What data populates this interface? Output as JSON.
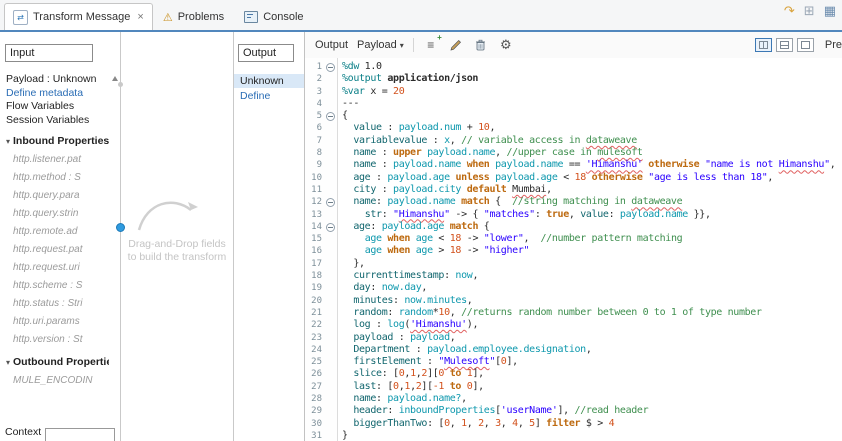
{
  "colors": {
    "accent_blue": "#5187bd",
    "link_blue": "#2a6db5",
    "selection_blue": "#d9e8f7",
    "anchor_blue": "#2f9be0"
  },
  "icons": {
    "transform": "⇄",
    "problems": "⚠",
    "chevron_down": "▾",
    "add_lines": "≡",
    "add_plus": "+",
    "gear": "⚙",
    "close": "×"
  },
  "window": {
    "toolbar_icons": [
      {
        "name": "annotation-icon",
        "glyph": "↷",
        "color": "#d9a33c"
      },
      {
        "name": "open-perspective-icon",
        "glyph": "⊞",
        "color": "#9aa7b5"
      },
      {
        "name": "mule-perspective-icon",
        "glyph": "▦",
        "color": "#6b8cae"
      }
    ]
  },
  "tabs": {
    "transform": {
      "label": "Transform Message",
      "close": "×"
    },
    "problems": {
      "label": "Problems"
    },
    "console": {
      "label": "Console"
    }
  },
  "input_panel": {
    "header": "Input",
    "context_label": "Context",
    "tree": [
      {
        "label": "Payload : Unknown",
        "style": "node"
      },
      {
        "label": "Define metadata",
        "style": "link"
      },
      {
        "label": "Flow Variables",
        "style": "node"
      },
      {
        "label": "Session Variables",
        "style": "node"
      },
      {
        "label": "Inbound Properties",
        "style": "group",
        "arrow": "▾"
      },
      {
        "label": "http.listener.pat",
        "style": "leaf"
      },
      {
        "label": "http.method : S",
        "style": "leaf"
      },
      {
        "label": "http.query.para",
        "style": "leaf"
      },
      {
        "label": "http.query.strin",
        "style": "leaf"
      },
      {
        "label": "http.remote.ad",
        "style": "leaf"
      },
      {
        "label": "http.request.pat",
        "style": "leaf"
      },
      {
        "label": "http.request.uri",
        "style": "leaf"
      },
      {
        "label": "http.scheme : S",
        "style": "leaf"
      },
      {
        "label": "http.status : Stri",
        "style": "leaf"
      },
      {
        "label": "http.uri.params",
        "style": "leaf"
      },
      {
        "label": "http.version : St",
        "style": "leaf"
      },
      {
        "label": "Outbound Propertie",
        "style": "group",
        "arrow": "▾"
      },
      {
        "label": "MULE_ENCODIN",
        "style": "leaf"
      }
    ]
  },
  "dropzone": {
    "hint1": "Drag-and-Drop fields",
    "hint2": "to build the transform"
  },
  "output_panel": {
    "header": "Output",
    "type": "Unknown",
    "define": "Define"
  },
  "editor": {
    "toolbar": {
      "output": "Output",
      "payload": "Payload",
      "preview": "Pre"
    },
    "lines": [
      {
        "n": 1,
        "f": 1,
        "t": [
          [
            "d",
            "%dw"
          ],
          [
            "p",
            " 1.0"
          ]
        ]
      },
      {
        "n": 2,
        "t": [
          [
            "d",
            "%output"
          ],
          [
            "p",
            " "
          ],
          [
            "b",
            "application/json"
          ]
        ]
      },
      {
        "n": 3,
        "t": [
          [
            "d",
            "%var"
          ],
          [
            "p",
            " x = "
          ],
          [
            "n",
            "20"
          ]
        ]
      },
      {
        "n": 4,
        "t": [
          [
            "p",
            "---"
          ]
        ]
      },
      {
        "n": 5,
        "f": 1,
        "t": [
          [
            "p",
            "{"
          ]
        ]
      },
      {
        "n": 6,
        "t": [
          [
            "p",
            "  "
          ],
          [
            "key",
            "value"
          ],
          [
            "p",
            " : "
          ],
          [
            "v",
            "payload.num"
          ],
          [
            "p",
            " + "
          ],
          [
            "n",
            "10"
          ],
          [
            "p",
            ","
          ]
        ]
      },
      {
        "n": 7,
        "t": [
          [
            "p",
            "  "
          ],
          [
            "key",
            "variablevalue"
          ],
          [
            "p",
            " : "
          ],
          [
            "v",
            "x"
          ],
          [
            "p",
            ", "
          ],
          [
            "c",
            "// variable access in "
          ],
          [
            "cu",
            "dataweave"
          ]
        ]
      },
      {
        "n": 8,
        "t": [
          [
            "p",
            "  "
          ],
          [
            "key",
            "name"
          ],
          [
            "p",
            " : "
          ],
          [
            "k",
            "upper"
          ],
          [
            "p",
            " "
          ],
          [
            "v",
            "payload.name"
          ],
          [
            "p",
            ", "
          ],
          [
            "c",
            "//upper case in "
          ],
          [
            "cu",
            "mulesoft"
          ]
        ]
      },
      {
        "n": 9,
        "t": [
          [
            "p",
            "  "
          ],
          [
            "key",
            "name"
          ],
          [
            "p",
            " : "
          ],
          [
            "v",
            "payload.name"
          ],
          [
            "p",
            " "
          ],
          [
            "k",
            "when"
          ],
          [
            "p",
            " "
          ],
          [
            "v",
            "payload.name"
          ],
          [
            "p",
            " == "
          ],
          [
            "su",
            "'Himanshu'"
          ],
          [
            "p",
            " "
          ],
          [
            "k",
            "otherwise"
          ],
          [
            "p",
            " "
          ],
          [
            "s",
            "\"name is not "
          ],
          [
            "su",
            "Himanshu"
          ],
          [
            "s",
            "\""
          ],
          [
            "p",
            ","
          ]
        ]
      },
      {
        "n": 10,
        "t": [
          [
            "p",
            "  "
          ],
          [
            "key",
            "age"
          ],
          [
            "p",
            " : "
          ],
          [
            "v",
            "payload.age"
          ],
          [
            "p",
            " "
          ],
          [
            "k",
            "unless"
          ],
          [
            "p",
            " "
          ],
          [
            "v",
            "payload.age"
          ],
          [
            "p",
            " < "
          ],
          [
            "n",
            "18"
          ],
          [
            "p",
            " "
          ],
          [
            "k",
            "otherwise"
          ],
          [
            "p",
            " "
          ],
          [
            "s",
            "\"age is less than 18\""
          ],
          [
            "p",
            ","
          ]
        ]
      },
      {
        "n": 11,
        "t": [
          [
            "p",
            "  "
          ],
          [
            "key",
            "city"
          ],
          [
            "p",
            " : "
          ],
          [
            "v",
            "payload.city"
          ],
          [
            "p",
            " "
          ],
          [
            "k",
            "default"
          ],
          [
            "p",
            " "
          ],
          [
            "pu",
            "Mumbai"
          ],
          [
            "p",
            ","
          ]
        ]
      },
      {
        "n": 12,
        "f": 1,
        "t": [
          [
            "p",
            "  "
          ],
          [
            "key",
            "name"
          ],
          [
            "p",
            ": "
          ],
          [
            "v",
            "payload.name"
          ],
          [
            "p",
            " "
          ],
          [
            "k",
            "match"
          ],
          [
            "p",
            " {  "
          ],
          [
            "c",
            "//string matching in "
          ],
          [
            "cu",
            "dataweave"
          ]
        ]
      },
      {
        "n": 13,
        "t": [
          [
            "p",
            "    "
          ],
          [
            "key",
            "str"
          ],
          [
            "p",
            ": "
          ],
          [
            "s",
            "\""
          ],
          [
            "su",
            "Himanshu"
          ],
          [
            "s",
            "\""
          ],
          [
            "p",
            " -> { "
          ],
          [
            "s",
            "\"matches\""
          ],
          [
            "p",
            ": "
          ],
          [
            "k",
            "true"
          ],
          [
            "p",
            ", "
          ],
          [
            "key",
            "value"
          ],
          [
            "p",
            ": "
          ],
          [
            "v",
            "payload.name"
          ],
          [
            "p",
            " }},"
          ]
        ]
      },
      {
        "n": 14,
        "f": 1,
        "t": [
          [
            "p",
            "  "
          ],
          [
            "key",
            "age"
          ],
          [
            "p",
            ": "
          ],
          [
            "v",
            "payload.age"
          ],
          [
            "p",
            " "
          ],
          [
            "k",
            "match"
          ],
          [
            "p",
            " {"
          ]
        ]
      },
      {
        "n": 15,
        "t": [
          [
            "p",
            "    "
          ],
          [
            "v",
            "age"
          ],
          [
            "p",
            " "
          ],
          [
            "k",
            "when"
          ],
          [
            "p",
            " "
          ],
          [
            "v",
            "age"
          ],
          [
            "p",
            " < "
          ],
          [
            "n",
            "18"
          ],
          [
            "p",
            " -> "
          ],
          [
            "s",
            "\"lower\""
          ],
          [
            "p",
            ",  "
          ],
          [
            "c",
            "//number pattern matching"
          ]
        ]
      },
      {
        "n": 16,
        "t": [
          [
            "p",
            "    "
          ],
          [
            "v",
            "age"
          ],
          [
            "p",
            " "
          ],
          [
            "k",
            "when"
          ],
          [
            "p",
            " "
          ],
          [
            "v",
            "age"
          ],
          [
            "p",
            " > "
          ],
          [
            "n",
            "18"
          ],
          [
            "p",
            " -> "
          ],
          [
            "s",
            "\"higher\""
          ]
        ]
      },
      {
        "n": 17,
        "t": [
          [
            "p",
            "  },"
          ]
        ]
      },
      {
        "n": 18,
        "t": [
          [
            "p",
            "  "
          ],
          [
            "key",
            "currenttimestamp"
          ],
          [
            "p",
            ": "
          ],
          [
            "v",
            "now"
          ],
          [
            "p",
            ","
          ]
        ]
      },
      {
        "n": 19,
        "t": [
          [
            "p",
            "  "
          ],
          [
            "key",
            "day"
          ],
          [
            "p",
            ": "
          ],
          [
            "v",
            "now.day"
          ],
          [
            "p",
            ","
          ]
        ]
      },
      {
        "n": 20,
        "t": [
          [
            "p",
            "  "
          ],
          [
            "key",
            "minutes"
          ],
          [
            "p",
            ": "
          ],
          [
            "v",
            "now.minutes"
          ],
          [
            "p",
            ","
          ]
        ]
      },
      {
        "n": 21,
        "t": [
          [
            "p",
            "  "
          ],
          [
            "key",
            "random"
          ],
          [
            "p",
            ": "
          ],
          [
            "v",
            "random"
          ],
          [
            "p",
            "*"
          ],
          [
            "n",
            "10"
          ],
          [
            "p",
            ", "
          ],
          [
            "c",
            "//returns random number between 0 to 1 of type number"
          ]
        ]
      },
      {
        "n": 22,
        "t": [
          [
            "p",
            "  "
          ],
          [
            "key",
            "log"
          ],
          [
            "p",
            " : "
          ],
          [
            "v",
            "log"
          ],
          [
            "p",
            "("
          ],
          [
            "su",
            "'Himanshu'"
          ],
          [
            "p",
            "),"
          ]
        ]
      },
      {
        "n": 23,
        "t": [
          [
            "p",
            "  "
          ],
          [
            "key",
            "payload"
          ],
          [
            "p",
            " : "
          ],
          [
            "v",
            "payload"
          ],
          [
            "p",
            ","
          ]
        ]
      },
      {
        "n": 24,
        "t": [
          [
            "p",
            "  "
          ],
          [
            "key",
            "Department"
          ],
          [
            "p",
            " : "
          ],
          [
            "v",
            "payload.employee.designation"
          ],
          [
            "p",
            ","
          ]
        ]
      },
      {
        "n": 25,
        "t": [
          [
            "p",
            "  "
          ],
          [
            "key",
            "firstElement"
          ],
          [
            "p",
            " : "
          ],
          [
            "s",
            "\""
          ],
          [
            "su",
            "Mulesoft"
          ],
          [
            "s",
            "\""
          ],
          [
            "p",
            "["
          ],
          [
            "n",
            "0"
          ],
          [
            "p",
            "],"
          ]
        ]
      },
      {
        "n": 26,
        "t": [
          [
            "p",
            "  "
          ],
          [
            "key",
            "slice"
          ],
          [
            "p",
            ": ["
          ],
          [
            "n",
            "0"
          ],
          [
            "p",
            ","
          ],
          [
            "n",
            "1"
          ],
          [
            "p",
            ","
          ],
          [
            "n",
            "2"
          ],
          [
            "p",
            "]["
          ],
          [
            "n",
            "0"
          ],
          [
            "p",
            " "
          ],
          [
            "k",
            "to"
          ],
          [
            "p",
            " "
          ],
          [
            "n",
            "1"
          ],
          [
            "p",
            "],"
          ]
        ]
      },
      {
        "n": 27,
        "t": [
          [
            "p",
            "  "
          ],
          [
            "key",
            "last"
          ],
          [
            "p",
            ": ["
          ],
          [
            "n",
            "0"
          ],
          [
            "p",
            ","
          ],
          [
            "n",
            "1"
          ],
          [
            "p",
            ","
          ],
          [
            "n",
            "2"
          ],
          [
            "p",
            "]["
          ],
          [
            "n",
            "-1"
          ],
          [
            "p",
            " "
          ],
          [
            "k",
            "to"
          ],
          [
            "p",
            " "
          ],
          [
            "n",
            "0"
          ],
          [
            "p",
            "],"
          ]
        ]
      },
      {
        "n": 28,
        "t": [
          [
            "p",
            "  "
          ],
          [
            "key",
            "name"
          ],
          [
            "p",
            ": "
          ],
          [
            "v",
            "payload.name?"
          ],
          [
            "p",
            ","
          ]
        ]
      },
      {
        "n": 29,
        "t": [
          [
            "p",
            "  "
          ],
          [
            "key",
            "header"
          ],
          [
            "p",
            ": "
          ],
          [
            "v",
            "inboundProperties"
          ],
          [
            "p",
            "["
          ],
          [
            "s",
            "'userName'"
          ],
          [
            "p",
            "], "
          ],
          [
            "c",
            "//read header"
          ]
        ]
      },
      {
        "n": 30,
        "t": [
          [
            "p",
            "  "
          ],
          [
            "key",
            "biggerThanTwo"
          ],
          [
            "p",
            ": ["
          ],
          [
            "n",
            "0"
          ],
          [
            "p",
            ", "
          ],
          [
            "n",
            "1"
          ],
          [
            "p",
            ", "
          ],
          [
            "n",
            "2"
          ],
          [
            "p",
            ", "
          ],
          [
            "n",
            "3"
          ],
          [
            "p",
            ", "
          ],
          [
            "n",
            "4"
          ],
          [
            "p",
            ", "
          ],
          [
            "n",
            "5"
          ],
          [
            "p",
            "] "
          ],
          [
            "k",
            "filter"
          ],
          [
            "p",
            " $ > "
          ],
          [
            "n",
            "4"
          ]
        ]
      },
      {
        "n": 31,
        "t": [
          [
            "p",
            "}"
          ]
        ]
      }
    ]
  }
}
